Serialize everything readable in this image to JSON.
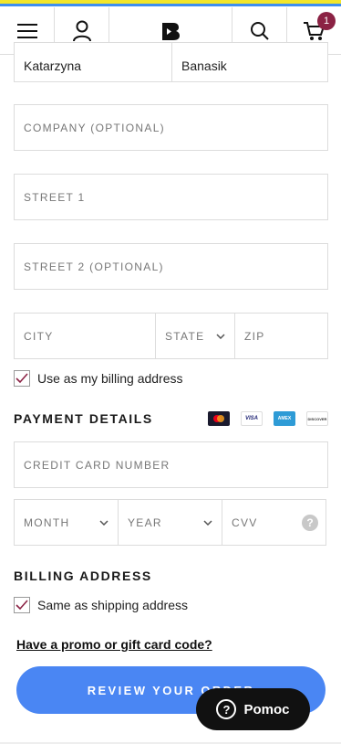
{
  "header": {
    "cart_count": "1"
  },
  "shipping": {
    "first_name": "Katarzyna",
    "last_name": "Banasik",
    "company_placeholder": "COMPANY (OPTIONAL)",
    "street1_placeholder": "STREET 1",
    "street2_placeholder": "STREET 2 (OPTIONAL)",
    "city_placeholder": "CITY",
    "state_placeholder": "STATE",
    "zip_placeholder": "ZIP",
    "billing_checkbox_label": "Use as my billing address"
  },
  "payment": {
    "title": "PAYMENT DETAILS",
    "card_number_placeholder": "CREDIT CARD NUMBER",
    "month_placeholder": "MONTH",
    "year_placeholder": "YEAR",
    "cvv_placeholder": "CVV",
    "cvv_help": "?",
    "cards": {
      "visa": "VISA",
      "amex": "AMEX",
      "discover": "DISCOVER"
    }
  },
  "billing": {
    "title": "BILLING ADDRESS",
    "same_checkbox_label": "Same as shipping address"
  },
  "promo_link": "Have a promo or gift card code?",
  "review_button": "REVIEW YOUR ORDER",
  "help_button": "Pomoc",
  "help_icon": "?"
}
